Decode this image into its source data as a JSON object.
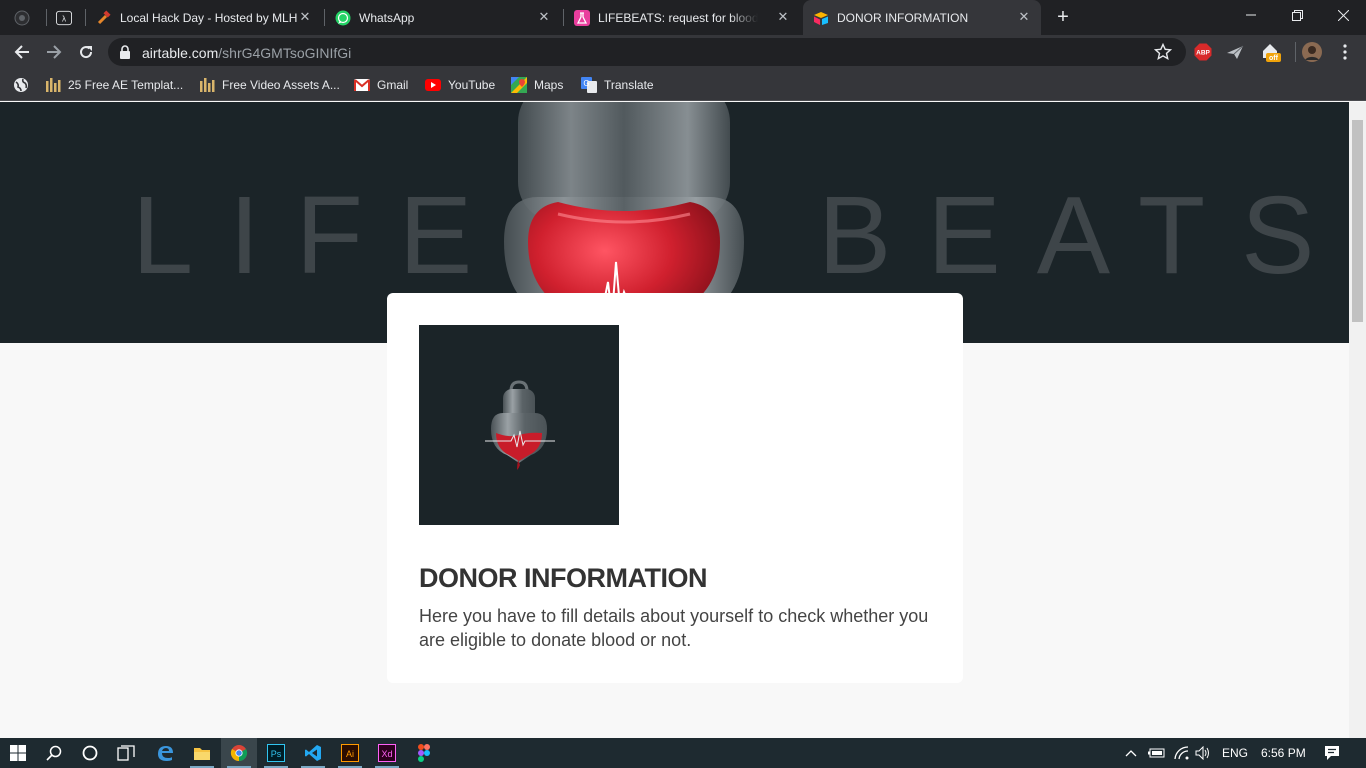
{
  "tabs": [
    {
      "title": "",
      "icon": "github-icon"
    },
    {
      "title": "",
      "icon": "lambda-icon"
    },
    {
      "title": "Local Hack Day - Hosted by MLH",
      "icon": "hammer-icon"
    },
    {
      "title": "WhatsApp",
      "icon": "whatsapp-icon"
    },
    {
      "title": "LIFEBEATS: request for blood - Ai",
      "icon": "flask-icon"
    },
    {
      "title": "DONOR INFORMATION",
      "icon": "airtable-icon"
    }
  ],
  "toolbar": {
    "url_host": "airtable.com",
    "url_path": "/shrG4GMTsoGINIfGi"
  },
  "extensions": {
    "abp_label": "ABP",
    "off_label": "off"
  },
  "bookmarks": [
    {
      "label": "25 Free AE Templat...",
      "icon": "bars-icon"
    },
    {
      "label": "Free Video Assets A...",
      "icon": "bars-icon"
    },
    {
      "label": "Gmail",
      "icon": "gmail-icon"
    },
    {
      "label": "YouTube",
      "icon": "youtube-icon"
    },
    {
      "label": "Maps",
      "icon": "maps-icon"
    },
    {
      "label": "Translate",
      "icon": "translate-icon"
    }
  ],
  "banner": {
    "left_word": "LIFE",
    "right_word": "BEATS"
  },
  "form": {
    "title": "DONOR INFORMATION",
    "description": "Here you have to fill details about yourself to check whether you are eligible to donate blood or not."
  },
  "taskbar": {
    "apps": [
      {
        "name": "Ps"
      },
      {
        "name": "Ai"
      },
      {
        "name": "Xd"
      }
    ],
    "language": "ENG",
    "time": "6:56 PM"
  },
  "colors": {
    "chrome_dark": "#202124",
    "chrome_toolbar": "#35363a",
    "banner_bg": "#1b2428",
    "blood_red": "#d0202e"
  }
}
